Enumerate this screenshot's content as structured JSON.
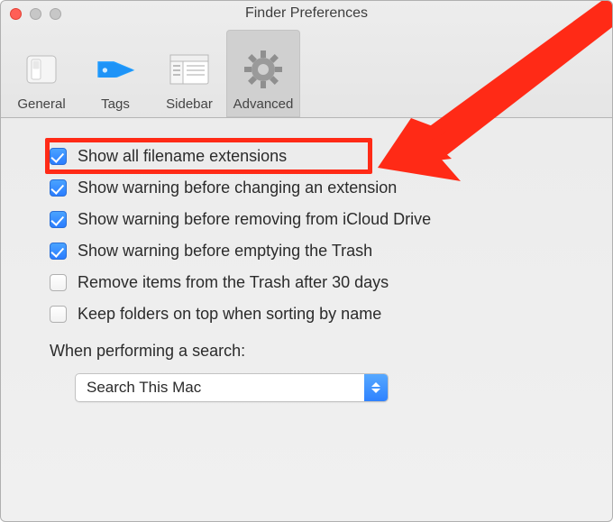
{
  "window": {
    "title": "Finder Preferences"
  },
  "toolbar": {
    "items": [
      {
        "label": "General"
      },
      {
        "label": "Tags"
      },
      {
        "label": "Sidebar"
      },
      {
        "label": "Advanced"
      }
    ]
  },
  "options": [
    {
      "label": "Show all filename extensions",
      "checked": true,
      "highlighted": true
    },
    {
      "label": "Show warning before changing an extension",
      "checked": true
    },
    {
      "label": "Show warning before removing from iCloud Drive",
      "checked": true
    },
    {
      "label": "Show warning before emptying the Trash",
      "checked": true
    },
    {
      "label": "Remove items from the Trash after 30 days",
      "checked": false
    },
    {
      "label": "Keep folders on top when sorting by name",
      "checked": false
    }
  ],
  "search": {
    "section_label": "When performing a search:",
    "selected": "Search This Mac"
  },
  "colors": {
    "accent": "#2f82ff",
    "highlight": "#ff2a16"
  }
}
